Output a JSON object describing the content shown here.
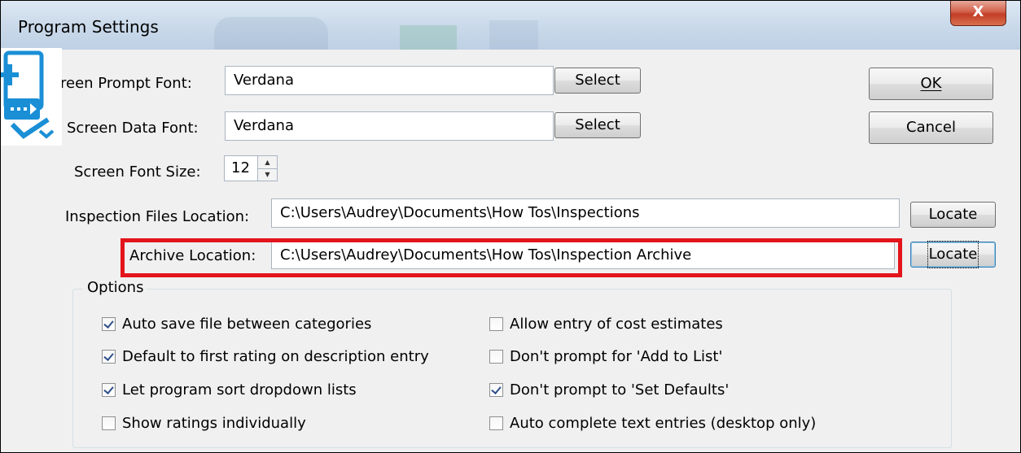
{
  "window": {
    "title": "Program Settings",
    "close_glyph": "X"
  },
  "fonts": {
    "prompt_label": "reen Prompt Font:",
    "prompt_value": "Verdana",
    "data_label": "Screen Data Font:",
    "data_value": "Verdana",
    "select_label": "Select",
    "size_label": "Screen Font Size:",
    "size_value": "12"
  },
  "buttons": {
    "ok": "OK",
    "cancel": "Cancel",
    "locate": "Locate"
  },
  "locations": {
    "inspection_label": "Inspection Files Location:",
    "inspection_value": "C:\\Users\\Audrey\\Documents\\How Tos\\Inspections",
    "archive_label": "Archive Location:",
    "archive_value": "C:\\Users\\Audrey\\Documents\\How Tos\\Inspection Archive"
  },
  "options": {
    "legend": "Options",
    "left": [
      {
        "label": "Auto save file between categories",
        "checked": true
      },
      {
        "label": "Default to first rating on description entry",
        "checked": true
      },
      {
        "label": "Let program sort dropdown lists",
        "checked": true
      },
      {
        "label": "Show ratings individually",
        "checked": false
      }
    ],
    "right": [
      {
        "label": "Allow entry of cost estimates",
        "checked": false
      },
      {
        "label": "Don't prompt for 'Add to List'",
        "checked": false
      },
      {
        "label": "Don't prompt to 'Set Defaults'",
        "checked": true
      },
      {
        "label": "Auto complete text entries (desktop only)",
        "checked": false
      }
    ]
  },
  "colors": {
    "highlight": "#e3141b",
    "logo": "#1a8fd6",
    "close": "#c8452c"
  },
  "icons": {
    "logo": "app-logo-icon",
    "spin_up": "spin-up-icon",
    "spin_down": "spin-down-icon"
  }
}
